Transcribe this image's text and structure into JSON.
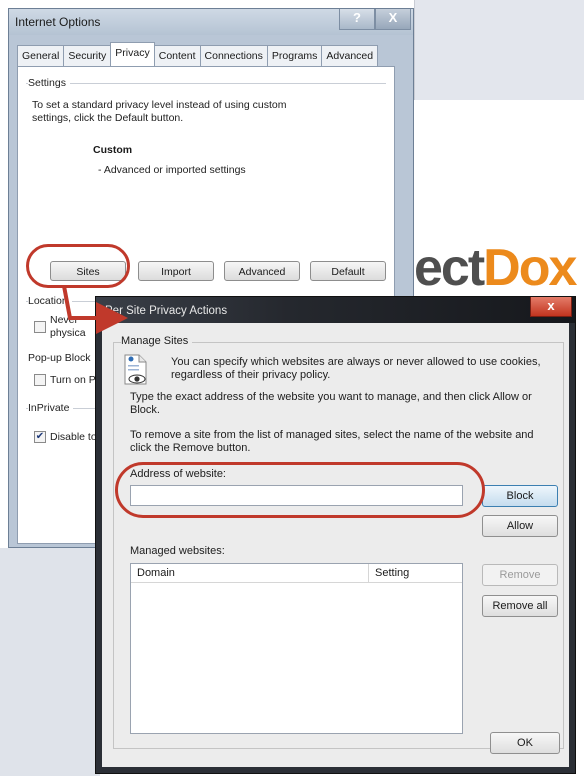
{
  "background": {
    "brand_text_main": "ect",
    "brand_text_accent": "Dox"
  },
  "internet_options": {
    "title": "Internet Options",
    "help_glyph": "?",
    "close_glyph": "X",
    "tabs": [
      {
        "label": "General",
        "active": false
      },
      {
        "label": "Security",
        "active": false
      },
      {
        "label": "Privacy",
        "active": true
      },
      {
        "label": "Content",
        "active": false
      },
      {
        "label": "Connections",
        "active": false
      },
      {
        "label": "Programs",
        "active": false
      },
      {
        "label": "Advanced",
        "active": false
      }
    ],
    "settings": {
      "group_label": "Settings",
      "description_line1": "To set a standard privacy level instead of using custom",
      "description_line2": "settings, click the Default button.",
      "level_title": "Custom",
      "level_detail": "- Advanced or imported settings"
    },
    "buttons": {
      "sites": "Sites",
      "import": "Import",
      "advanced": "Advanced",
      "default": "Default"
    },
    "location": {
      "group_label": "Location",
      "checkbox_label_line1": "Never",
      "checkbox_label_line2": "physica",
      "checked": false
    },
    "popup_blocker": {
      "group_label": "Pop-up Block",
      "checkbox_label": "Turn on P",
      "checked": false
    },
    "inprivate": {
      "group_label": "InPrivate",
      "checkbox_label": "Disable to",
      "checked": true
    }
  },
  "per_site_dialog": {
    "title": "Per Site Privacy Actions",
    "close_glyph": "x",
    "group_label": "Manage Sites",
    "intro_line1": "You can specify which websites are always or never allowed to use cookies,",
    "intro_line2": "regardless of their privacy policy.",
    "instruction_line1": "Type the exact address of the website you want to manage, and then click Allow or",
    "instruction_line2": "Block.",
    "remove_line1": "To remove a site from the list of managed sites, select the name of the website and",
    "remove_line2": "click the Remove button.",
    "address_label": "Address of website:",
    "address_value": "",
    "buttons": {
      "block": "Block",
      "allow": "Allow",
      "remove": "Remove",
      "remove_all": "Remove all",
      "ok": "OK"
    },
    "managed_label": "Managed websites:",
    "columns": [
      "Domain",
      "Setting"
    ],
    "rows": []
  },
  "annotation_color": "#c0392b"
}
